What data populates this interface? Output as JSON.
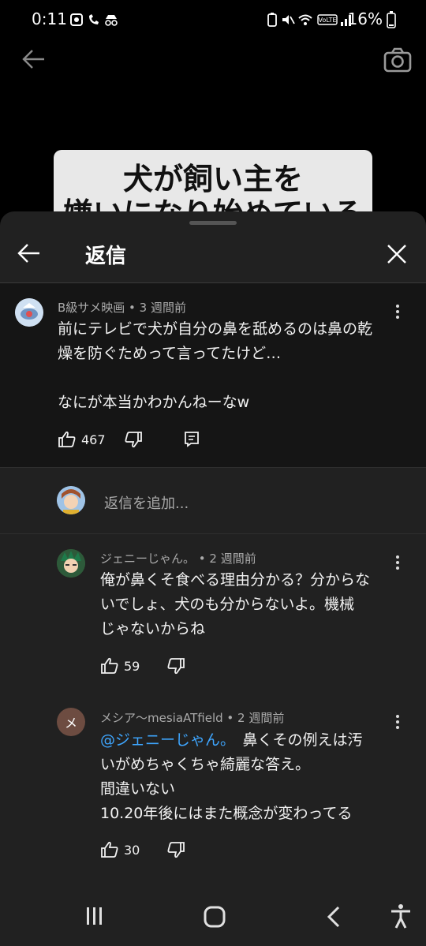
{
  "status_bar": {
    "time": "0:11",
    "battery": "16%"
  },
  "video": {
    "title_line1": "犬が飼い主を",
    "title_line2": "嫌いになり始めている"
  },
  "sheet": {
    "title": "返信"
  },
  "top_comment": {
    "author": "B級サメ映画 • 3 週間前",
    "lines": [
      "前にテレビで犬が自分の鼻を舐めるのは鼻の乾",
      "燥を防ぐためって言ってたけど…",
      "",
      "なにが本当かわかんねーなw"
    ],
    "likes": "467"
  },
  "add_reply": {
    "placeholder": "返信を追加..."
  },
  "replies": [
    {
      "author": "ジェニーじゃん。 • 2 週間前",
      "lines": [
        "俺が鼻くそ食べる理由分かる？分からな",
        "いでしょ、犬のも分からないよ。機械",
        "じゃないからね"
      ],
      "likes": "59"
    },
    {
      "author": "メシア〜mesiaATfield • 2 週間前",
      "avatar_letter": "メ",
      "mention": "@ジェニーじゃん。",
      "first_line_rest": "　鼻くその例えは汚",
      "lines": [
        "いがめちゃくちゃ綺麗な答え。",
        "間違いない",
        "10.20年後にはまた概念が変わってる"
      ],
      "likes": "30"
    }
  ],
  "colors": {
    "sheet_bg": "#212121",
    "top_comment_bg": "#151515",
    "mention": "#3ea6ff",
    "meta": "#aaaaaa"
  },
  "icons": [
    "back-arrow-icon",
    "camera-icon",
    "close-icon",
    "like-icon",
    "dislike-icon",
    "reply-icon",
    "more-vert-icon",
    "recent-apps-icon",
    "home-icon",
    "back-icon",
    "accessibility-icon"
  ]
}
